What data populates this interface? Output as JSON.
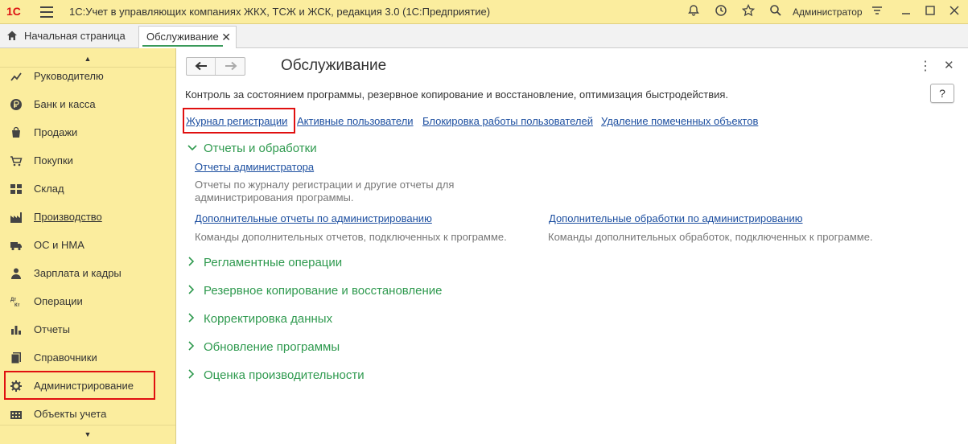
{
  "app": {
    "logo": "1С",
    "title": "1С:Учет в управляющих компаниях ЖКХ, ТСЖ и ЖСК, редакция 3.0  (1С:Предприятие)",
    "user": "Администратор"
  },
  "tabs": {
    "home": "Начальная страница",
    "active": "Обслуживание"
  },
  "sidebar": {
    "items": [
      {
        "label": "Руководителю",
        "icon": "chart-line-icon"
      },
      {
        "label": "Банк и касса",
        "icon": "ruble-icon"
      },
      {
        "label": "Продажи",
        "icon": "bag-icon"
      },
      {
        "label": "Покупки",
        "icon": "cart-icon"
      },
      {
        "label": "Склад",
        "icon": "warehouse-icon"
      },
      {
        "label": "Производство",
        "icon": "factory-icon"
      },
      {
        "label": "ОС и НМА",
        "icon": "truck-icon"
      },
      {
        "label": "Зарплата и кадры",
        "icon": "person-icon"
      },
      {
        "label": "Операции",
        "icon": "dt-kt-icon"
      },
      {
        "label": "Отчеты",
        "icon": "bar-chart-icon"
      },
      {
        "label": "Справочники",
        "icon": "books-icon"
      },
      {
        "label": "Администрирование",
        "icon": "gear-icon"
      },
      {
        "label": "Объекты учета",
        "icon": "building-icon"
      }
    ]
  },
  "main": {
    "title": "Обслуживание",
    "description": "Контроль за состоянием программы, резервное копирование и восстановление, оптимизация быстродействия.",
    "help": "?",
    "top_links": [
      "Журнал регистрации",
      "Активные пользователи",
      "Блокировка работы пользователей",
      "Удаление помеченных объектов"
    ],
    "reports_section": {
      "title": "Отчеты и обработки",
      "admin_reports_link": "Отчеты администратора",
      "admin_reports_desc_1": "Отчеты по журналу регистрации и другие отчеты для",
      "admin_reports_desc_2": "администрирования программы.",
      "extra_reports_link": "Дополнительные отчеты по администрированию",
      "extra_reports_desc": "Команды дополнительных отчетов, подключенных к программе.",
      "extra_processing_link": "Дополнительные обработки по администрированию",
      "extra_processing_desc": "Команды дополнительных обработок, подключенных к программе."
    },
    "collapsed_sections": [
      "Регламентные операции",
      "Резервное копирование и восстановление",
      "Корректировка данных",
      "Обновление программы",
      "Оценка производительности"
    ]
  },
  "colors": {
    "sidebar_bg": "#fbed9e",
    "link": "#1d4fa0",
    "section_green": "#2f9a4f",
    "highlight_red": "#e01010"
  }
}
